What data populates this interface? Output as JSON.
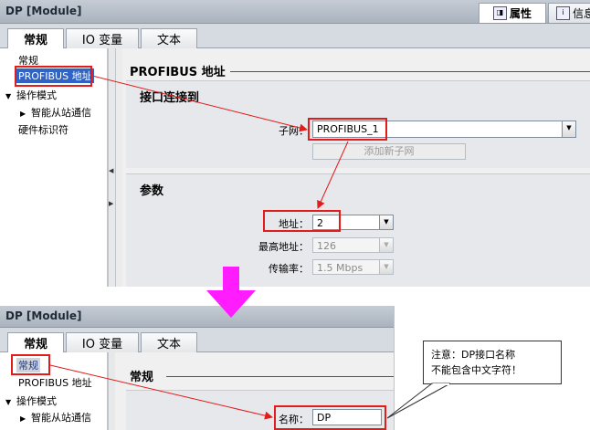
{
  "top": {
    "window_title": "DP [Module]",
    "inspector_tabs": [
      {
        "label": "属性",
        "icon": "properties-icon"
      },
      {
        "label": "信息",
        "icon": "info-icon"
      }
    ],
    "tabs": [
      "常规",
      "IO 变量",
      "文本"
    ],
    "nav": {
      "general": "常规",
      "profibus_address": "PROFIBUS 地址",
      "operating_mode": "操作模式",
      "intelligent_slave": "智能从站通信",
      "hw_identifier": "硬件标识符"
    },
    "section_title": "PROFIBUS 地址",
    "interface_group": {
      "title": "接口连接到",
      "subnet_label": "子网：",
      "subnet_value": "PROFIBUS_1",
      "add_subnet_button": "添加新子网"
    },
    "params_group": {
      "title": "参数",
      "address_label": "地址：",
      "address_value": "2",
      "highest_address_label": "最高地址：",
      "highest_address_value": "126",
      "baud_rate_label": "传输率：",
      "baud_rate_value": "1.5 Mbps"
    }
  },
  "bottom": {
    "window_title": "DP [Module]",
    "tabs": [
      "常规",
      "IO 变量",
      "文本"
    ],
    "nav": {
      "general": "常规",
      "profibus_address": "PROFIBUS 地址",
      "operating_mode": "操作模式",
      "intelligent_slave": "智能从站通信"
    },
    "section_title": "常规",
    "name_label": "名称：",
    "name_value": "DP"
  },
  "callout": {
    "line1": "注意：DP接口名称",
    "line2": "不能包含中文字符！"
  },
  "colors": {
    "annotation_red": "#e21b1b",
    "transition_arrow": "#ff1cff",
    "selection_blue": "#2f63c6"
  }
}
